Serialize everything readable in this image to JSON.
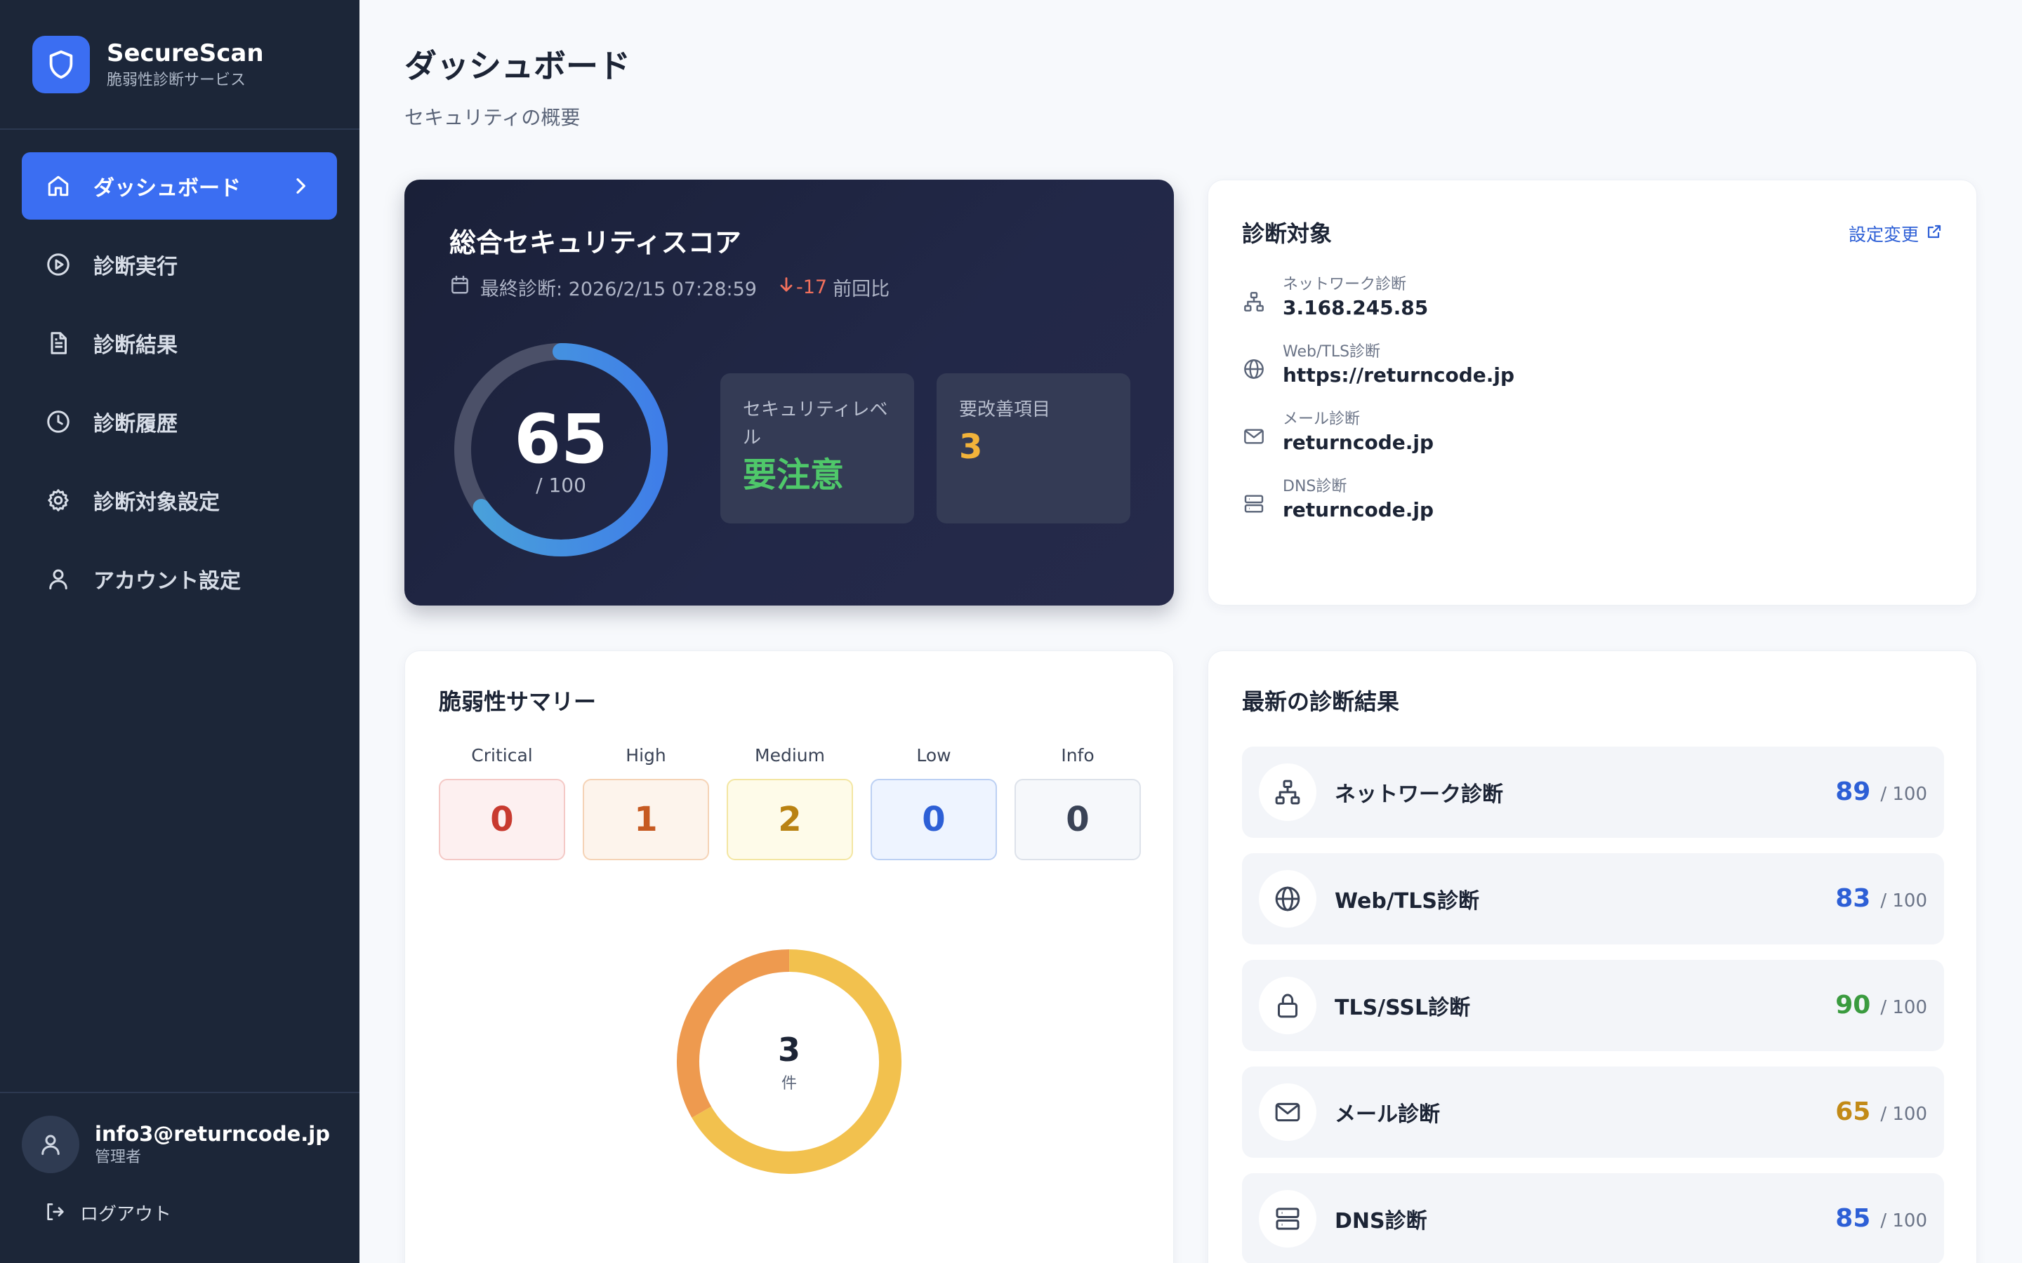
{
  "brand": {
    "name": "SecureScan",
    "subtitle": "脆弱性診断サービス"
  },
  "nav": {
    "items": [
      {
        "label": "ダッシュボード",
        "icon": "home-icon",
        "active": true
      },
      {
        "label": "診断実行",
        "icon": "play-circle-icon"
      },
      {
        "label": "診断結果",
        "icon": "document-icon"
      },
      {
        "label": "診断履歴",
        "icon": "clock-icon"
      },
      {
        "label": "診断対象設定",
        "icon": "gear-icon"
      },
      {
        "label": "アカウント設定",
        "icon": "user-icon"
      }
    ]
  },
  "user": {
    "email": "info3@returncode.jp",
    "role": "管理者",
    "logout_label": "ログアウト"
  },
  "header": {
    "title": "ダッシュボード",
    "subtitle": "セキュリティの概要"
  },
  "score": {
    "title": "総合セキュリティスコア",
    "last_scan_label": "最終診断: 2026/2/15 07:28:59",
    "delta": "-17",
    "delta_suffix": "前回比",
    "value": "65",
    "max_label": "/ 100",
    "fraction": 0.65,
    "level_label": "セキュリティレベル",
    "level_value": "要注意",
    "improve_label": "要改善項目",
    "improve_value": "3"
  },
  "targets": {
    "title": "診断対象",
    "edit_label": "設定変更",
    "items": [
      {
        "label": "ネットワーク診断",
        "value": "3.168.245.85",
        "icon": "network-icon"
      },
      {
        "label": "Web/TLS診断",
        "value": "https://returncode.jp",
        "icon": "globe-icon"
      },
      {
        "label": "メール診断",
        "value": "returncode.jp",
        "icon": "mail-icon"
      },
      {
        "label": "DNS診断",
        "value": "returncode.jp",
        "icon": "server-icon"
      }
    ]
  },
  "vuln": {
    "title": "脆弱性サマリー",
    "severities": [
      {
        "label": "Critical",
        "value": "0",
        "color": "#c83a2f",
        "bg": "#fdf0f0",
        "border": "#f4c9c6"
      },
      {
        "label": "High",
        "value": "1",
        "color": "#c65a22",
        "bg": "#fdf4ec",
        "border": "#f5d3b6"
      },
      {
        "label": "Medium",
        "value": "2",
        "color": "#b98212",
        "bg": "#fefbe9",
        "border": "#f3e6a2"
      },
      {
        "label": "Low",
        "value": "0",
        "color": "#2d5fd6",
        "bg": "#eef4ff",
        "border": "#bcd0f3"
      },
      {
        "label": "Info",
        "value": "0",
        "color": "#3a4356",
        "bg": "#f6f8fb",
        "border": "#dde2ea"
      }
    ],
    "donut": {
      "total": "3",
      "unit": "件",
      "segments": [
        {
          "name": "High",
          "value": 1,
          "color": "#ee9a4f"
        },
        {
          "name": "Medium",
          "value": 2,
          "color": "#f2c14e"
        }
      ]
    }
  },
  "results": {
    "title": "最新の診断結果",
    "items": [
      {
        "label": "ネットワーク診断",
        "score": "89",
        "max": "/ 100",
        "color": "#2d5fd6",
        "icon": "network-icon"
      },
      {
        "label": "Web/TLS診断",
        "score": "83",
        "max": "/ 100",
        "color": "#2d5fd6",
        "icon": "globe-icon"
      },
      {
        "label": "TLS/SSL診断",
        "score": "90",
        "max": "/ 100",
        "color": "#3a9b3f",
        "icon": "lock-icon"
      },
      {
        "label": "メール診断",
        "score": "65",
        "max": "/ 100",
        "color": "#c28a17",
        "icon": "mail-icon"
      },
      {
        "label": "DNS診断",
        "score": "85",
        "max": "/ 100",
        "color": "#2d5fd6",
        "icon": "server-icon"
      }
    ]
  },
  "colors": {
    "accent": "#3b6ef2",
    "level_warning": "#4fc86a",
    "improve": "#f2b33a",
    "delta_down": "#f2705c",
    "gauge_track": "#4b5068",
    "gauge_start": "#3f7ee8",
    "gauge_end": "#4aa3d9"
  }
}
